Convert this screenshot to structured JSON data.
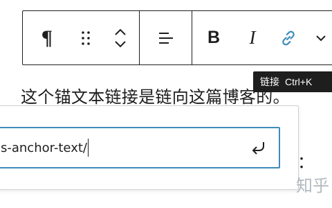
{
  "toolbar": {
    "paragraph_icon": "¶",
    "drag_icon": "drag-handle-icon",
    "move_icon": "chevron-up-down-icon",
    "align_icon": "align-left-icon",
    "bold_label": "B",
    "italic_label": "I",
    "link_icon": "link-icon",
    "more_icon": "chevron-down-icon"
  },
  "tooltip": {
    "label": "链接",
    "shortcut": "Ctrl+K"
  },
  "content": {
    "paragraph": "这个锚文本链接是链向这篇博客的。",
    "trailing_colon": "："
  },
  "link_popover": {
    "url_value": "s-anchor-text/",
    "submit_icon": "enter-icon"
  },
  "watermark": "知乎",
  "colors": {
    "focus": "#3d8bb8",
    "link_icon": "#3d8bb8",
    "text": "#1e1e1e",
    "tooltip_bg": "#1e1e1e"
  }
}
